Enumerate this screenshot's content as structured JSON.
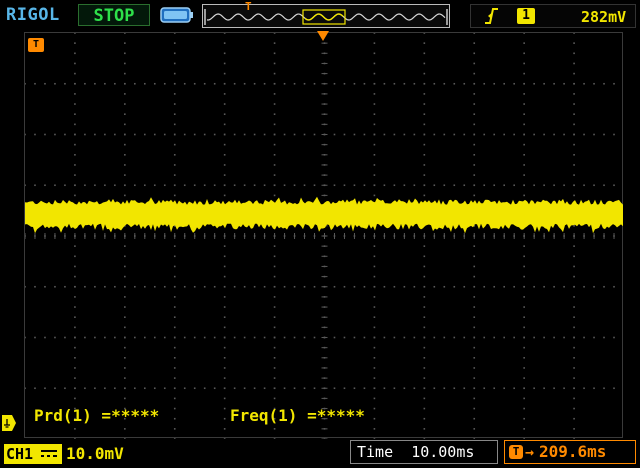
{
  "header": {
    "brand": "RIGOL",
    "run_state": "STOP",
    "trigger_marker": "T",
    "trigger_source": "1",
    "trigger_level": "282mV"
  },
  "plot": {
    "channel_offset_marker": "T",
    "trigger_position_marker": "T",
    "grid": {
      "h_divisions": 12,
      "v_divisions": 8
    },
    "trace": {
      "color": "#f2e600",
      "level_fraction": 0.445
    }
  },
  "measurements": [
    {
      "label": "Prd(1) =*****"
    },
    {
      "label": "Freq(1) =*****"
    }
  ],
  "footer": {
    "channel_label": "CH1",
    "channel_scale": "10.0mV",
    "time_label": "Time",
    "time_value": "10.00ms",
    "trigger_offset_icon": "T",
    "trigger_offset_arrow": "→",
    "trigger_offset_value": "209.6ms"
  },
  "colors": {
    "ch1": "#f2e600",
    "trigger": "#ff8a00",
    "brand": "#58b6e8",
    "stop": "#2ee04a",
    "grid": "#5a5a5a"
  }
}
